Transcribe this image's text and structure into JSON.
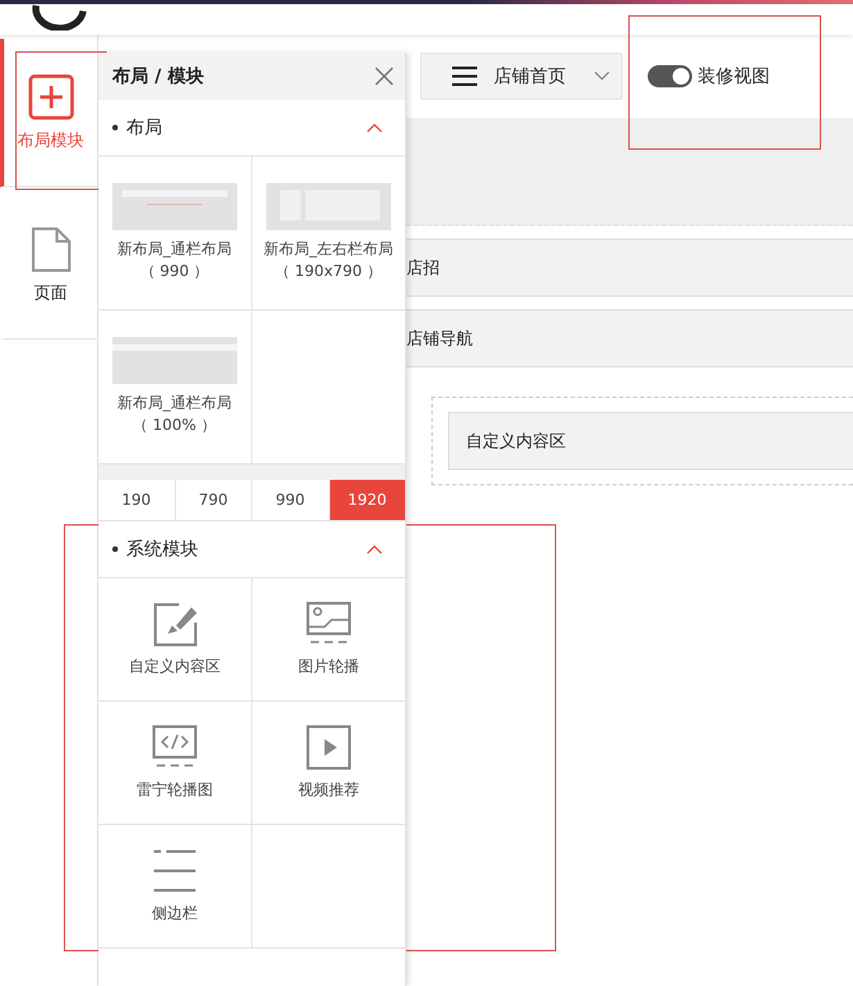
{
  "sidebar": {
    "items": [
      {
        "label": "布局模块",
        "kind": "add",
        "selected": true
      },
      {
        "label": "页面",
        "kind": "page",
        "selected": false
      }
    ]
  },
  "panel": {
    "title": "布局 / 模块",
    "sections": [
      {
        "title": "布局",
        "expanded": true,
        "items": [
          {
            "label": "新布局_通栏布局",
            "sub": "（ 990 ）",
            "kind": "full"
          },
          {
            "label": "新布局_左右栏布局",
            "sub": "（ 190x790 ）",
            "kind": "split"
          },
          {
            "label": "新布局_通栏布局",
            "sub": "（ 100% ）",
            "kind": "wide"
          }
        ],
        "sizes": [
          {
            "label": "190",
            "selected": false
          },
          {
            "label": "790",
            "selected": false
          },
          {
            "label": "990",
            "selected": false
          },
          {
            "label": "1920",
            "selected": true
          }
        ]
      },
      {
        "title": "系统模块",
        "expanded": true,
        "items": [
          {
            "label": "自定义内容区",
            "kind": "edit"
          },
          {
            "label": "图片轮播",
            "kind": "image"
          },
          {
            "label": "雷宁轮播图",
            "kind": "code"
          },
          {
            "label": "视频推荐",
            "kind": "video"
          },
          {
            "label": "侧边栏",
            "kind": "sidebar"
          }
        ]
      }
    ]
  },
  "toolbar": {
    "page_menu": "店铺首页",
    "toggle": {
      "label": "装修视图",
      "on": true
    }
  },
  "canvas": {
    "rows": [
      "店招",
      "店铺导航"
    ],
    "custom_area": "自定义内容区"
  }
}
